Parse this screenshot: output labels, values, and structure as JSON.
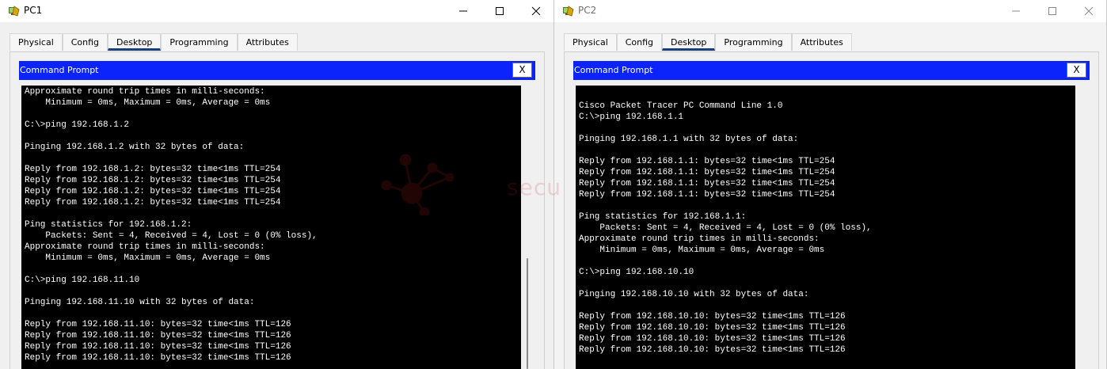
{
  "windows": [
    {
      "title": "PC1",
      "tabs": [
        "Physical",
        "Config",
        "Desktop",
        "Programming",
        "Attributes"
      ],
      "active_tab": "Desktop",
      "command_prompt_title": "Command Prompt",
      "close_label": "X",
      "console_lines": [
        "Approximate round trip times in milli-seconds:",
        "    Minimum = 0ms, Maximum = 0ms, Average = 0ms",
        "",
        "C:\\>ping 192.168.1.2",
        "",
        "Pinging 192.168.1.2 with 32 bytes of data:",
        "",
        "Reply from 192.168.1.2: bytes=32 time<1ms TTL=254",
        "Reply from 192.168.1.2: bytes=32 time<1ms TTL=254",
        "Reply from 192.168.1.2: bytes=32 time<1ms TTL=254",
        "Reply from 192.168.1.2: bytes=32 time<1ms TTL=254",
        "",
        "Ping statistics for 192.168.1.2:",
        "    Packets: Sent = 4, Received = 4, Lost = 0 (0% loss),",
        "Approximate round trip times in milli-seconds:",
        "    Minimum = 0ms, Maximum = 0ms, Average = 0ms",
        "",
        "C:\\>ping 192.168.11.10",
        "",
        "Pinging 192.168.11.10 with 32 bytes of data:",
        "",
        "Reply from 192.168.11.10: bytes=32 time<1ms TTL=126",
        "Reply from 192.168.11.10: bytes=32 time<1ms TTL=126",
        "Reply from 192.168.11.10: bytes=32 time<1ms TTL=126",
        "Reply from 192.168.11.10: bytes=32 time<1ms TTL=126"
      ]
    },
    {
      "title": "PC2",
      "tabs": [
        "Physical",
        "Config",
        "Desktop",
        "Programming",
        "Attributes"
      ],
      "active_tab": "Desktop",
      "command_prompt_title": "Command Prompt",
      "close_label": "X",
      "console_lines": [
        "",
        "Cisco Packet Tracer PC Command Line 1.0",
        "C:\\>ping 192.168.1.1",
        "",
        "Pinging 192.168.1.1 with 32 bytes of data:",
        "",
        "Reply from 192.168.1.1: bytes=32 time<1ms TTL=254",
        "Reply from 192.168.1.1: bytes=32 time<1ms TTL=254",
        "Reply from 192.168.1.1: bytes=32 time<1ms TTL=254",
        "Reply from 192.168.1.1: bytes=32 time<1ms TTL=254",
        "",
        "Ping statistics for 192.168.1.1:",
        "    Packets: Sent = 4, Received = 4, Lost = 0 (0% loss),",
        "Approximate round trip times in milli-seconds:",
        "    Minimum = 0ms, Maximum = 0ms, Average = 0ms",
        "",
        "C:\\>ping 192.168.10.10",
        "",
        "Pinging 192.168.10.10 with 32 bytes of data:",
        "",
        "Reply from 192.168.10.10: bytes=32 time<1ms TTL=126",
        "Reply from 192.168.10.10: bytes=32 time<1ms TTL=126",
        "Reply from 192.168.10.10: bytes=32 time<1ms TTL=126",
        "Reply from 192.168.10.10: bytes=32 time<1ms TTL=126"
      ]
    }
  ],
  "watermark_text": "secu",
  "icons": {
    "app": "packet-tracer-pc-icon",
    "minimize": "minimize-icon",
    "maximize": "maximize-icon",
    "close": "close-icon"
  },
  "colors": {
    "command_bar": "#0b24fb",
    "console_bg": "#000000",
    "console_fg": "#ffffff",
    "active_tab_underline": "#1a3e7a"
  }
}
